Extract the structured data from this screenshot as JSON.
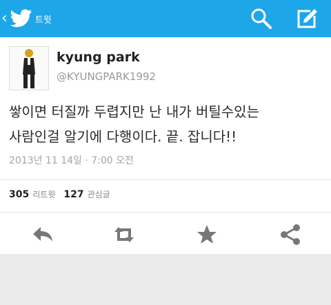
{
  "topbar": {
    "title": "트윗",
    "back_glyph": "‹",
    "icons": [
      "twitter-bird-icon",
      "search-icon",
      "compose-icon"
    ],
    "color": "#1da7e9"
  },
  "tweet": {
    "user_name": "kyung park",
    "handle": "@KYUNGPARK1992",
    "text_line_1": "쌓이면 터질까 두렵지만 난 내가 버틸수있는",
    "text_line_2": "사람인걸  알기에 다행이다. 끝. 잡니다!!",
    "timestamp": "2013년 11 14일 · 7:00 오전",
    "retweets_count": "305",
    "retweets_label": "리트윗",
    "favorites_count": "127",
    "favorites_label": "관심글"
  },
  "actions": {
    "icons": [
      "reply-icon",
      "retweet-icon",
      "favorite-star-icon",
      "share-icon"
    ],
    "color": "#777777"
  }
}
